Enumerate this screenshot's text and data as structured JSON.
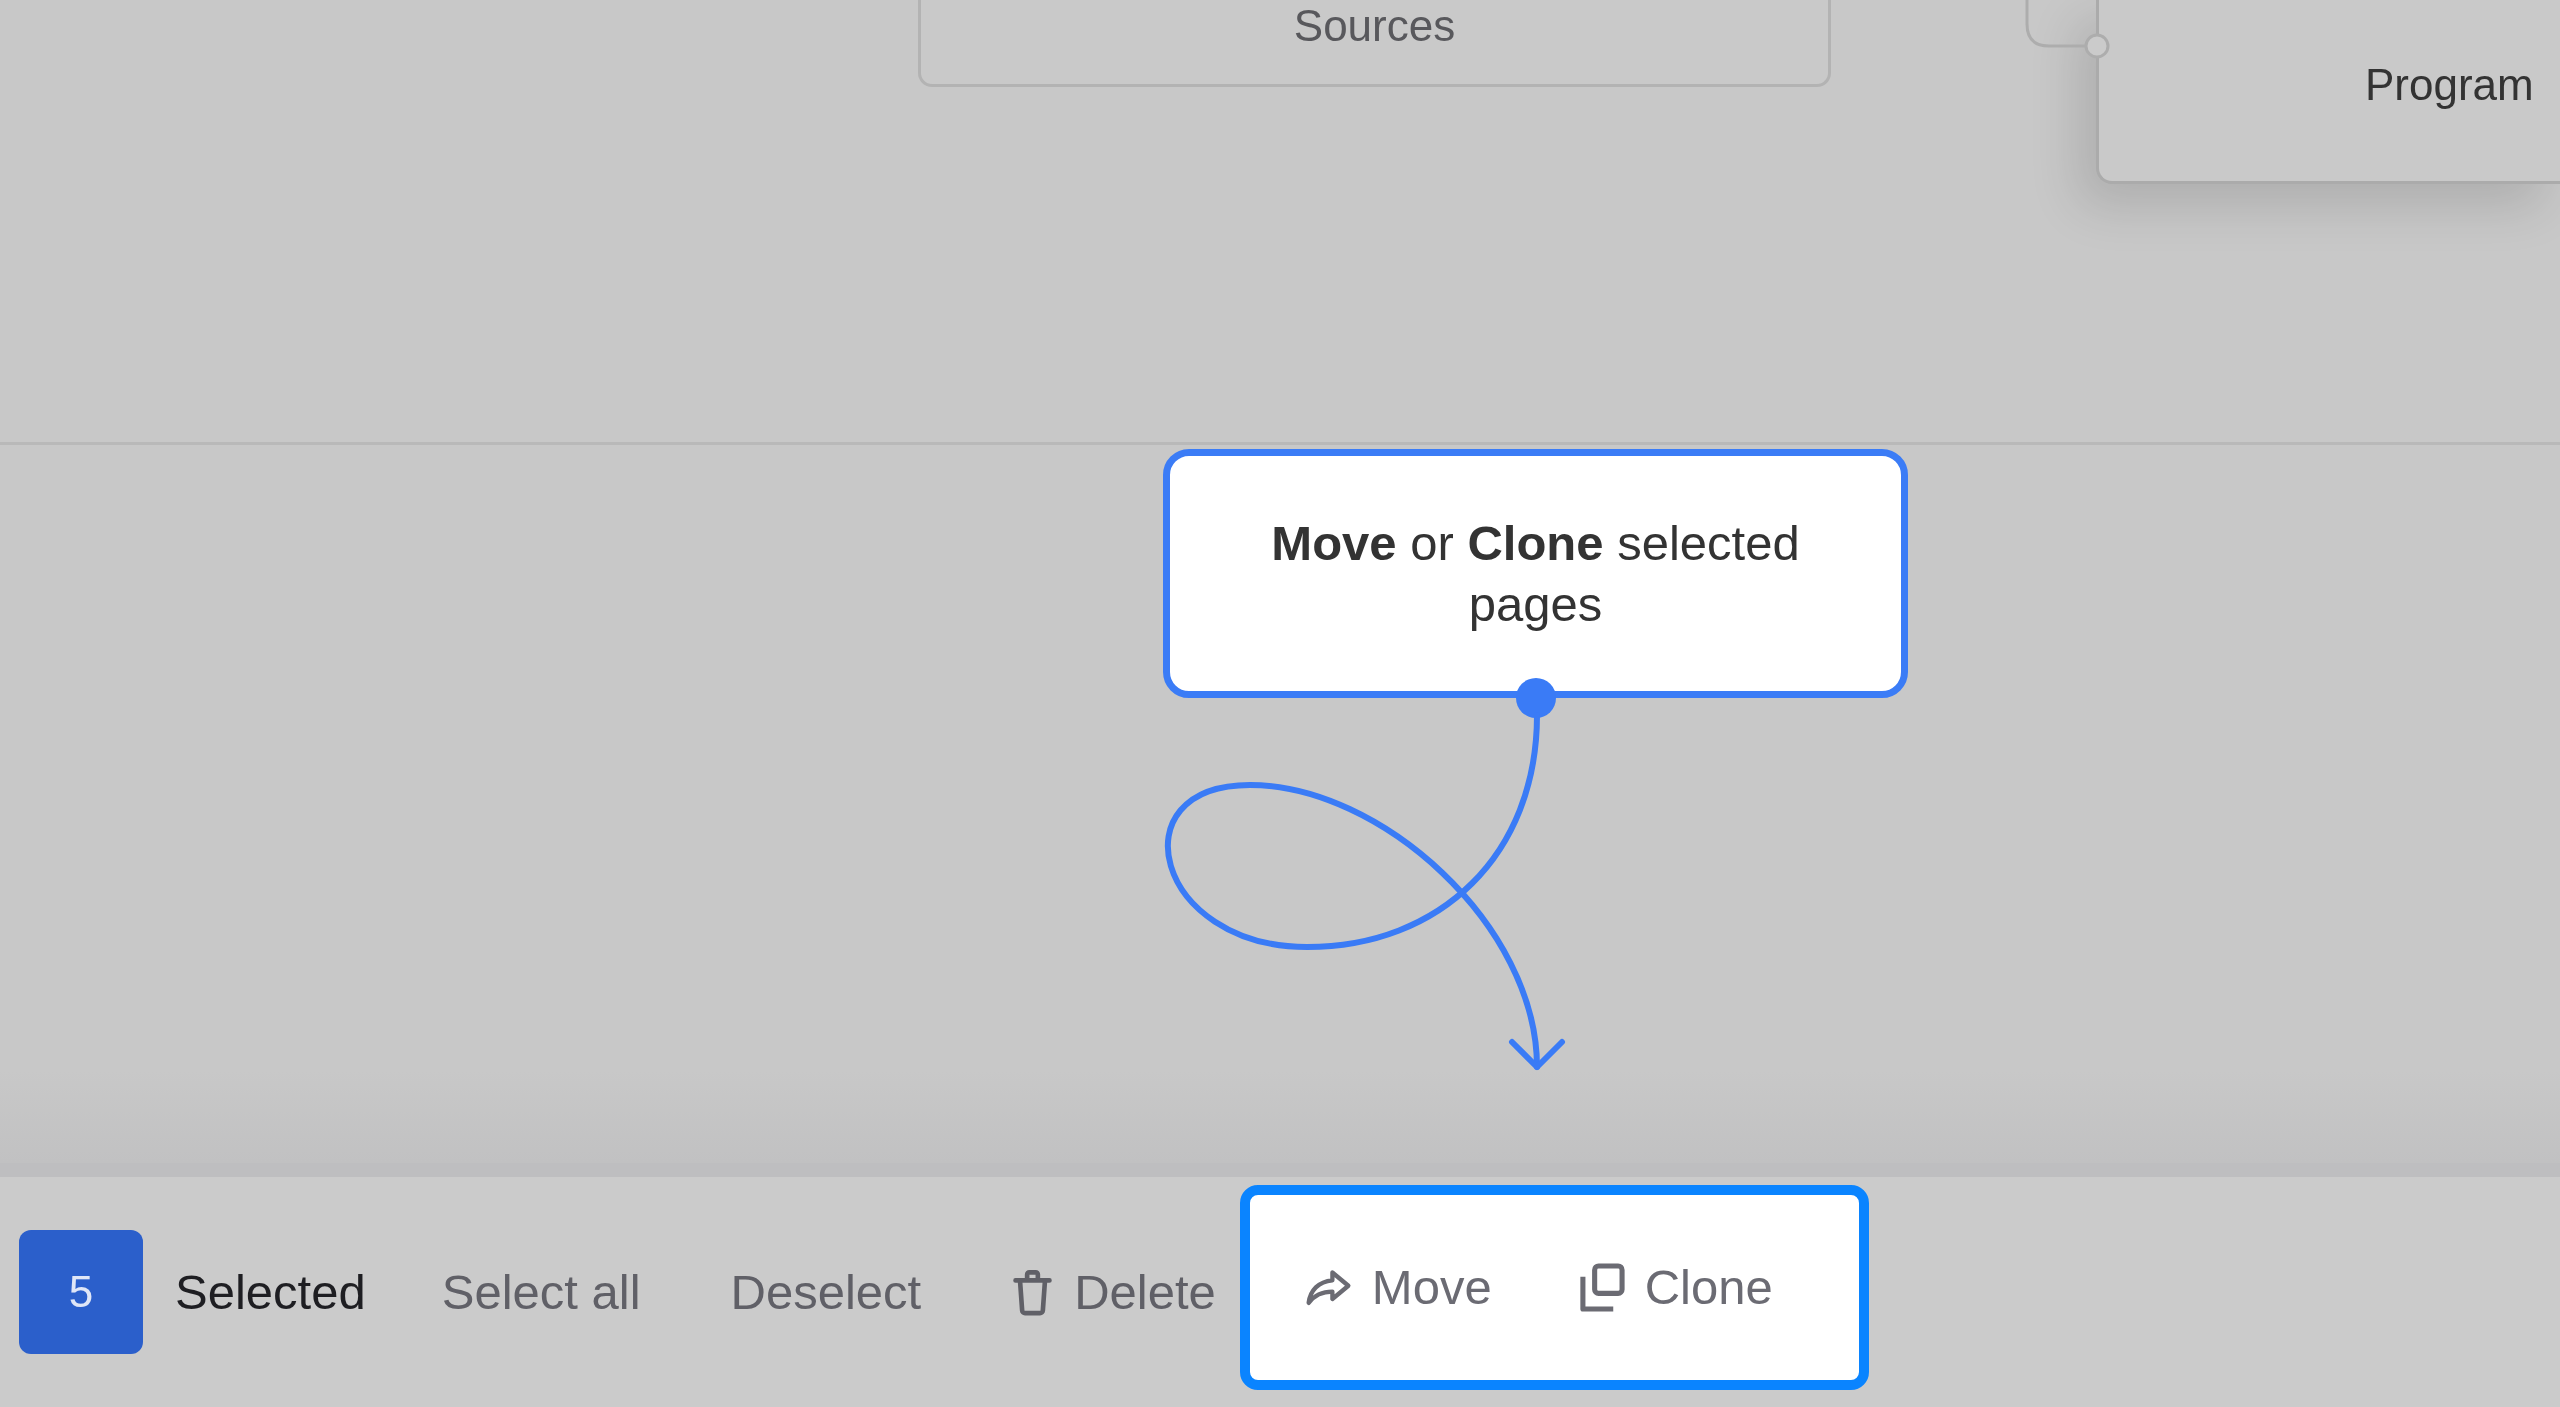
{
  "canvas": {
    "nodes": [
      {
        "label": "Sources",
        "connected": false,
        "raised": false
      },
      {
        "label": "Program",
        "connected": true,
        "raised": true
      }
    ]
  },
  "tooltip": {
    "text": "**Move** or **Clone** selected pages"
  },
  "selection_bar": {
    "count": "5",
    "count_label": "Selected",
    "actions": [
      {
        "label": "Select all",
        "kind": "plain",
        "highlighted": false
      },
      {
        "label": "Deselect",
        "kind": "plain",
        "highlighted": false
      },
      {
        "label": "Delete",
        "kind": "delete",
        "highlighted": false
      },
      {
        "label": "Move",
        "kind": "move",
        "highlighted": true
      },
      {
        "label": "Clone",
        "kind": "clone",
        "highlighted": true
      }
    ]
  }
}
